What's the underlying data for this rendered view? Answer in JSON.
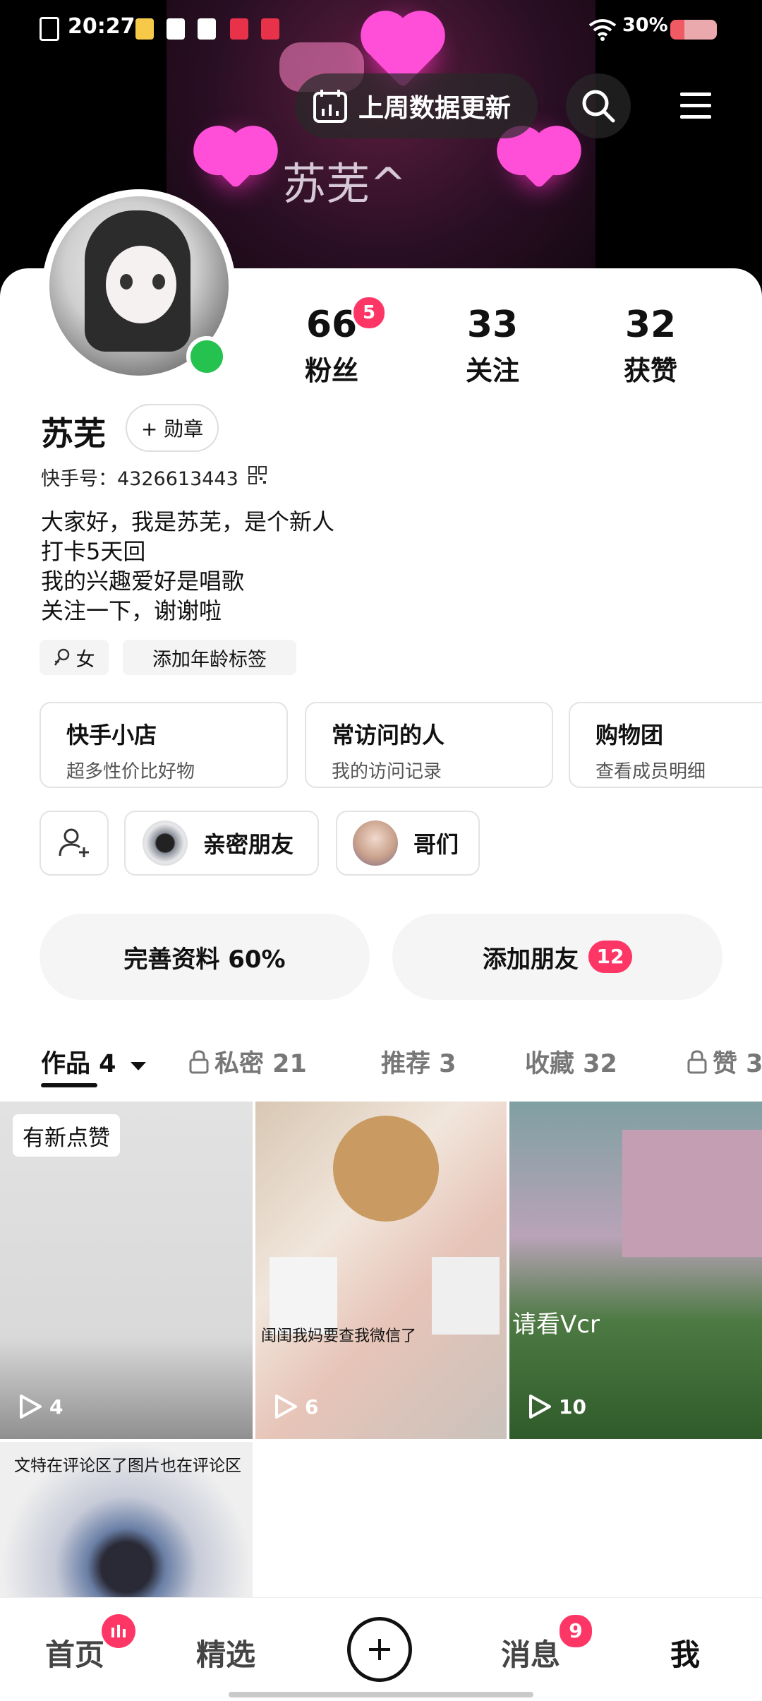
{
  "status_bar": {
    "time": "20:27",
    "battery": "30%",
    "battery_level": 0.3
  },
  "header": {
    "banner_name": "苏芜^",
    "data_update_label": "上周数据更新"
  },
  "profile": {
    "stats": [
      {
        "value": "66",
        "label": "粉丝",
        "badge": "5"
      },
      {
        "value": "33",
        "label": "关注"
      },
      {
        "value": "32",
        "label": "获赞"
      }
    ],
    "name": "苏芜",
    "medal_label": "+ 勋章",
    "kuaishou_id": "快手号：4326613443",
    "bio": [
      "大家好，我是苏芜，是个新人",
      "打卡5天回",
      "我的兴趣爱好是唱歌",
      "关注一下，谢谢啦"
    ],
    "tags": [
      "女",
      "添加年龄标签"
    ]
  },
  "entries": [
    {
      "title": "快手小店",
      "sub": "超多性价比好物"
    },
    {
      "title": "常访问的人",
      "sub": "我的访问记录"
    },
    {
      "title": "购物团",
      "sub": "查看成员明细"
    }
  ],
  "friends": [
    {
      "label": "亲密朋友"
    },
    {
      "label": "哥们"
    }
  ],
  "actions": {
    "complete_profile": "完善资料 60%",
    "add_friends": "添加朋友",
    "add_friends_badge": "12"
  },
  "tabs": [
    "作品 4",
    "私密 21",
    "推荐 3",
    "收藏 32",
    "赞 3"
  ],
  "grid": [
    {
      "badge": "有新点赞",
      "plays": "4"
    },
    {
      "plays": "6",
      "caption": "闺闺我妈要查我微信了"
    },
    {
      "plays": "10",
      "caption": "请看Vcr"
    },
    {
      "caption": "文特在评论区了图片也在评论区"
    }
  ],
  "nav": {
    "items": [
      "首页",
      "精选",
      "消息",
      "我"
    ],
    "messages_badge": "9"
  },
  "colors": {
    "accent": "#fe3666",
    "online": "#25c24f"
  }
}
